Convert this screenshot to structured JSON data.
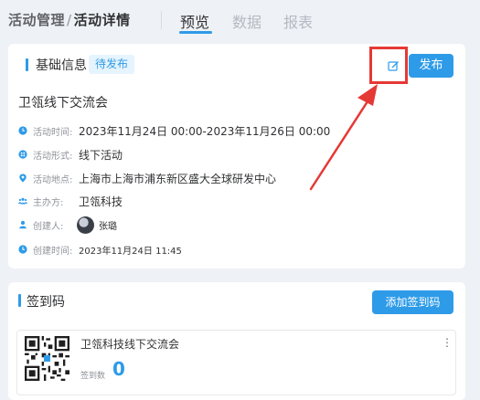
{
  "breadcrumb": {
    "parent": "活动管理",
    "separator": "/",
    "current": "活动详情"
  },
  "tabs": [
    {
      "label": "预览",
      "active": true
    },
    {
      "label": "数据",
      "active": false
    },
    {
      "label": "报表",
      "active": false
    }
  ],
  "basic": {
    "section_title": "基础信息",
    "status_badge": "待发布",
    "publish_label": "发布",
    "activity_title": "卫瓴线下交流会",
    "fields": [
      {
        "icon": "clock-icon",
        "label": "活动时间:",
        "value": "2023年11月24日 00:00-2023年11月26日 00:00"
      },
      {
        "icon": "grid-icon",
        "label": "活动形式:",
        "value": "线下活动"
      },
      {
        "icon": "location-pin-icon",
        "label": "活动地点:",
        "value": "上海市上海市浦东新区盛大全球研发中心"
      },
      {
        "icon": "group-icon",
        "label": "主办方:",
        "value": "卫瓴科技"
      },
      {
        "icon": "user-icon",
        "label": "创建人:",
        "value": "张璐"
      },
      {
        "icon": "clock-icon",
        "label": "创建时间:",
        "value": "2023年11月24日 11:45"
      }
    ]
  },
  "checkin": {
    "section_title": "签到码",
    "add_label": "添加签到码",
    "item_title": "卫瓴科技线下交流会",
    "count_label": "签到数",
    "count_value": "0",
    "more_glyph": "⋮"
  },
  "colors": {
    "accent": "#2e9be8",
    "highlight": "#e53935"
  }
}
